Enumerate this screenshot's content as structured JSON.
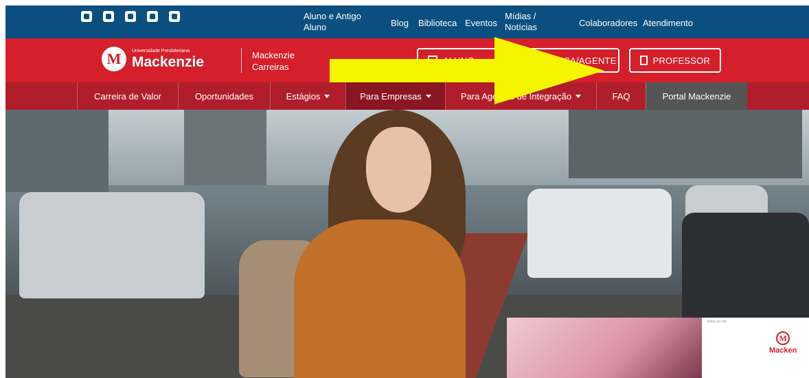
{
  "topbar": {
    "social_icons": [
      "facebook-icon",
      "twitter-icon",
      "youtube-icon",
      "linkedin-icon",
      "instagram-icon"
    ],
    "links": [
      {
        "label": "Aluno e Antigo\nAluno"
      },
      {
        "label": "Blog"
      },
      {
        "label": "Biblioteca"
      },
      {
        "label": "Eventos"
      },
      {
        "label": "Mídias /\nNotícias"
      },
      {
        "label": "Colaboradores"
      },
      {
        "label": "Atendimento"
      }
    ]
  },
  "header": {
    "logo_small": "Universidade Presbiteriana",
    "logo_big": "Mackenzie",
    "logo_mark": "M",
    "site_name_line1": "Mackenzie",
    "site_name_line2": "Carreiras",
    "buttons": {
      "aluno": "ALUNO",
      "empresa": "EMPRESA/AGENTE",
      "professor": "PROFESSOR"
    }
  },
  "nav": {
    "items": [
      {
        "label": "Carreira de Valor"
      },
      {
        "label": "Oportunidades"
      },
      {
        "label": "Estágios"
      },
      {
        "label": "Para Empresas"
      },
      {
        "label": "Para Agentes de Integração"
      },
      {
        "label": "FAQ"
      },
      {
        "label": "Portal Mackenzie"
      }
    ]
  },
  "popup": {
    "back_label": "Voltar ao site",
    "logo_mark": "M",
    "logo_text": "Macken"
  },
  "colors": {
    "topbar": "#0b4f80",
    "header": "#d51f2b",
    "nav": "#b01e2c",
    "nav_active": "#8a1623",
    "portal": "#555555",
    "arrow": "#f5f500"
  }
}
